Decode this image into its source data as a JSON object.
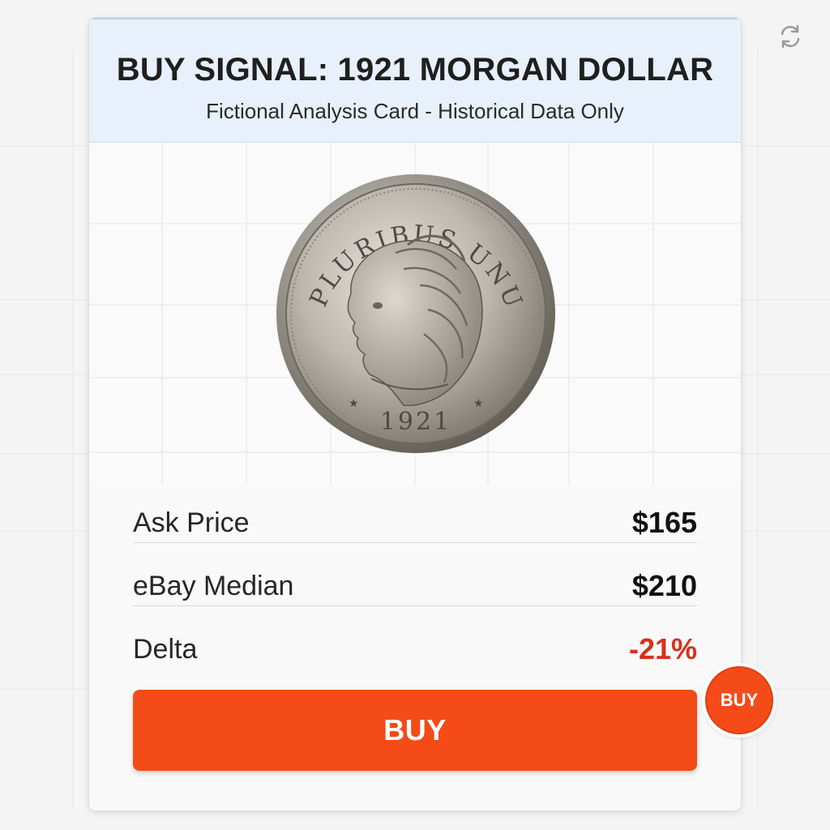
{
  "card": {
    "title": "BUY SIGNAL: 1921 MORGAN DOLLAR",
    "subtitle": "Fictional Analysis Card - Historical Data Only"
  },
  "coin": {
    "legend_text": "E PLURIBUS UNUM",
    "year": "1921",
    "image_name": "morgan-dollar-coin-image"
  },
  "stats": [
    {
      "label": "Ask Price",
      "value": "$165"
    },
    {
      "label": "eBay Median",
      "value": "$210"
    },
    {
      "label": "Delta",
      "value": "-21%"
    }
  ],
  "actions": {
    "buy_label": "BUY",
    "badge_label": "BUY"
  },
  "icons": {
    "refresh": "refresh-icon"
  },
  "colors": {
    "accent": "#f44b18",
    "header_bg": "#e8f0fb",
    "negative": "#d6321c"
  }
}
